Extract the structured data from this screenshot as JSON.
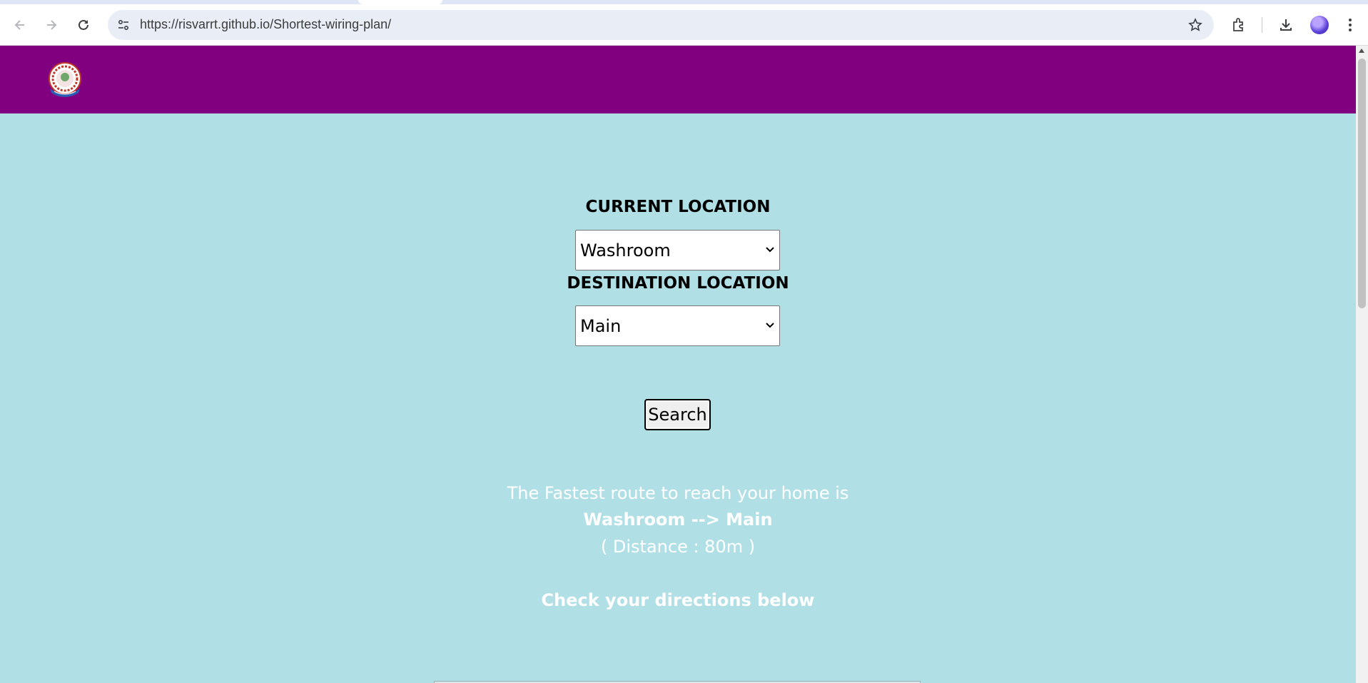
{
  "browser": {
    "url": "https://risvarrt.github.io/Shortest-wiring-plan/"
  },
  "form": {
    "current_label": "CURRENT LOCATION",
    "current_value": "Washroom",
    "destination_label": "DESTINATION LOCATION",
    "destination_value": "Main",
    "search_label": "Search"
  },
  "result": {
    "line1": "The Fastest route to reach your home is",
    "route": "Washroom --> Main",
    "distance": "( Distance : 80m )",
    "directions": "Check your directions below"
  },
  "colors": {
    "header": "#800080",
    "background": "#b0dfe5",
    "result_text": "#ffffff"
  }
}
